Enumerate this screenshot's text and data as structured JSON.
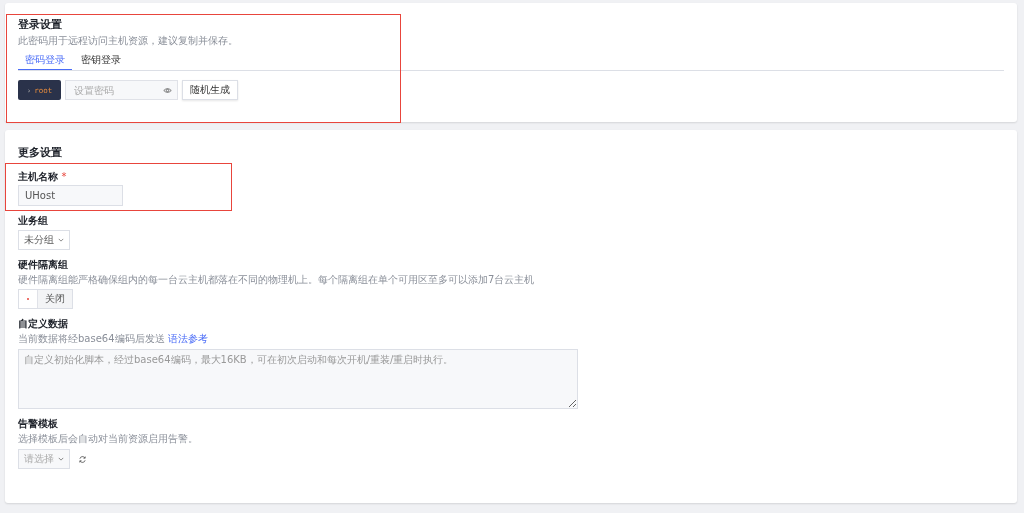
{
  "login": {
    "title": "登录设置",
    "description": "此密码用于远程访问主机资源，建议复制并保存。",
    "tabs": [
      {
        "label": "密码登录",
        "selected": true
      },
      {
        "label": "密钥登录",
        "selected": false
      }
    ],
    "user": "root",
    "user_prompt": "›",
    "password": {
      "placeholder": "设置密码"
    },
    "generate_button": "随机生成"
  },
  "more": {
    "title": "更多设置",
    "hostname": {
      "label": "主机名称",
      "required_mark": "*",
      "value": "UHost"
    },
    "group": {
      "label": "业务组",
      "value": "未分组"
    },
    "isolation": {
      "label": "硬件隔离组",
      "description": "硬件隔离组能严格确保组内的每一台云主机都落在不同的物理机上。每个隔离组在单个可用区至多可以添加7台云主机",
      "toggle": {
        "label": "关闭",
        "on": false
      }
    },
    "userdata": {
      "label": "自定义数据",
      "description": "当前数据将经base64编码后发送",
      "link": "语法参考",
      "placeholder": "自定义初始化脚本，经过base64编码，最大16KB，可在初次启动和每次开机/重装/重启时执行。"
    },
    "alarm": {
      "label": "告警模板",
      "description": "选择模板后会自动对当前资源启用告警。",
      "select": {
        "placeholder": "请选择"
      }
    }
  }
}
